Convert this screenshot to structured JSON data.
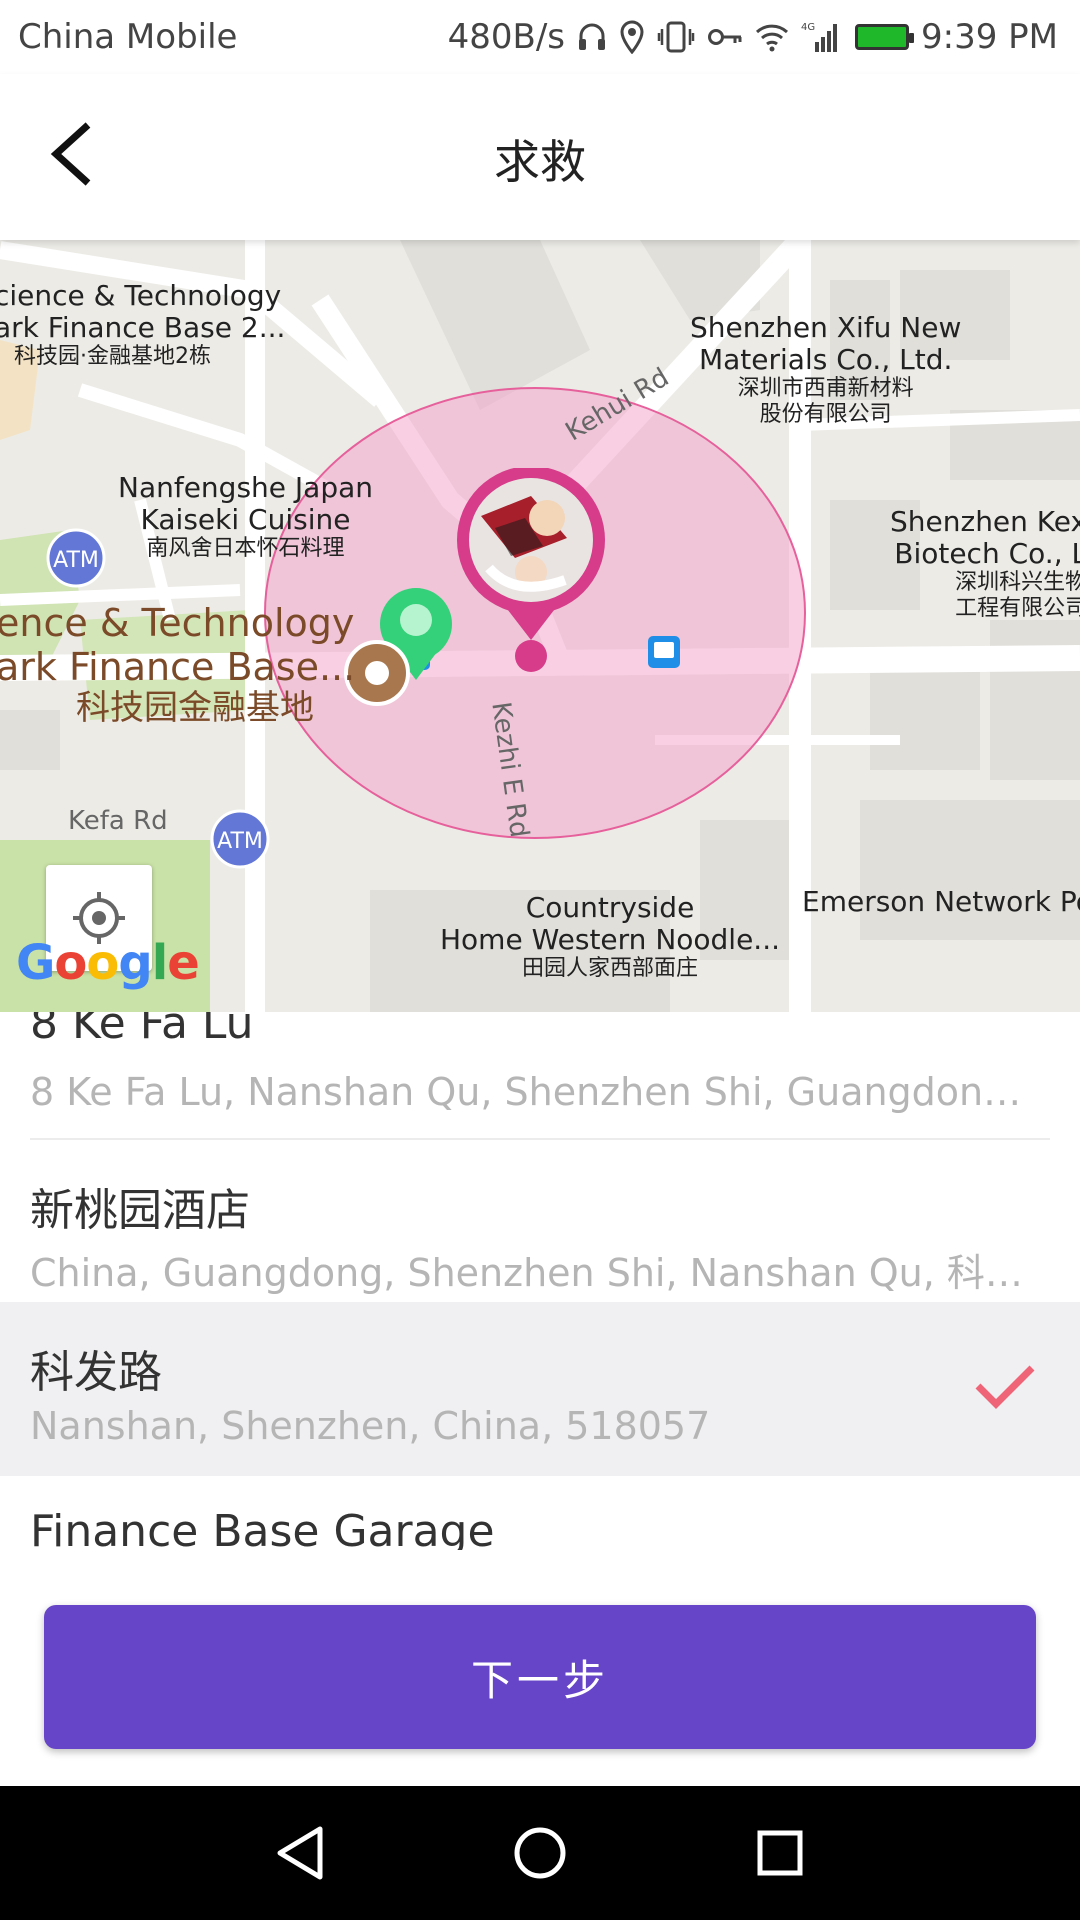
{
  "status_bar": {
    "carrier": "China Mobile",
    "speed": "480B/s",
    "network": "4G",
    "time": "9:39 PM"
  },
  "header": {
    "title": "求救"
  },
  "map": {
    "pois": [
      {
        "en1": "cience & Technology",
        "en2": "ark Finance Base 2...",
        "zh": "科技园·金融基地2栋"
      },
      {
        "en1": "Shenzhen Xifu New",
        "en2": "Materials Co., Ltd.",
        "zh1": "深圳市西甫新材料",
        "zh2": "股份有限公司"
      },
      {
        "en1": "Nanfengshe Japan",
        "en2": "Kaiseki Cuisine",
        "zh": "南风舍日本怀石料理"
      },
      {
        "en1": "Shenzhen Kex",
        "en2": "Biotech Co., L",
        "zh1": "深圳科兴生物",
        "zh2": "工程有限公司"
      },
      {
        "en1": "ence & Technology",
        "en2": "ark Finance Base...",
        "zh": "科技园金融基地"
      },
      {
        "en1": "Countryside",
        "en2": "Home Western Noodle...",
        "zh": "田园人家西部面庄"
      },
      {
        "en1": "Emerson Network Po"
      }
    ],
    "roads": {
      "kehui": "Kehui Rd",
      "kezhi": "Kezhi E Rd",
      "kefa": "Kefa Rd"
    },
    "atm_label": "ATM",
    "google_letters": [
      "G",
      "o",
      "o",
      "g",
      "l",
      "e"
    ],
    "geofence_color": "#e87aa8",
    "pin_color": "#d63c8a"
  },
  "places": [
    {
      "name": "8 Ke Fa Lu",
      "address": "8 Ke Fa Lu, Nanshan Qu, Shenzhen Shi, Guangdong S..."
    },
    {
      "name": "新桃园酒店",
      "address": "China, Guangdong, Shenzhen Shi, Nanshan Qu, 科技..."
    },
    {
      "name": "科发路",
      "address": "Nanshan, Shenzhen, China, 518057",
      "selected": true
    },
    {
      "name": "Finance Base Garage",
      "address": ""
    }
  ],
  "actions": {
    "next_label": "下一步"
  },
  "colors": {
    "accent": "#6745c8",
    "check": "#f06478"
  }
}
